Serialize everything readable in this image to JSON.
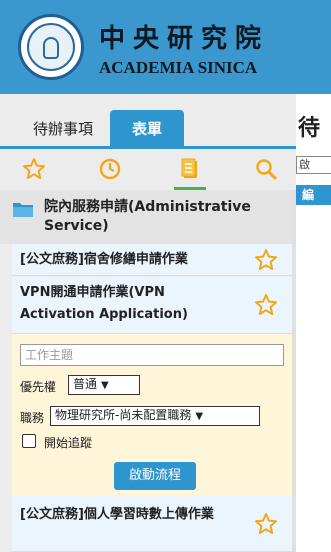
{
  "header": {
    "org_cn": "中央研究院",
    "org_en": "ACADEMIA SINICA"
  },
  "tabs": [
    {
      "label": "待辦事項"
    },
    {
      "label": "表單"
    }
  ],
  "iconbar": [
    "star-icon",
    "clock-icon",
    "document-icon",
    "search-icon"
  ],
  "category": {
    "label": "院內服務申請(Administrative Service)"
  },
  "items": [
    {
      "label": "[公文庶務]宿舍修繕申請作業"
    },
    {
      "label": "VPN開通申請作業(VPN Activation Application)"
    },
    {
      "label": "[公文庶務]個人學習時數上傳作業"
    }
  ],
  "form": {
    "subject_placeholder": "工作主題",
    "priority_label": "優先權",
    "priority_value": "普通",
    "job_label": "職務",
    "job_value": "物理研究所-尚未配置職務",
    "track_label": "開始追蹤",
    "start_button": "啟動流程"
  },
  "right_panel": {
    "title": "待",
    "field": "啟",
    "bar": "編"
  },
  "colors": {
    "accent": "#2f95cf",
    "header": "#3a98cf",
    "expanded": "#fff5d9"
  }
}
